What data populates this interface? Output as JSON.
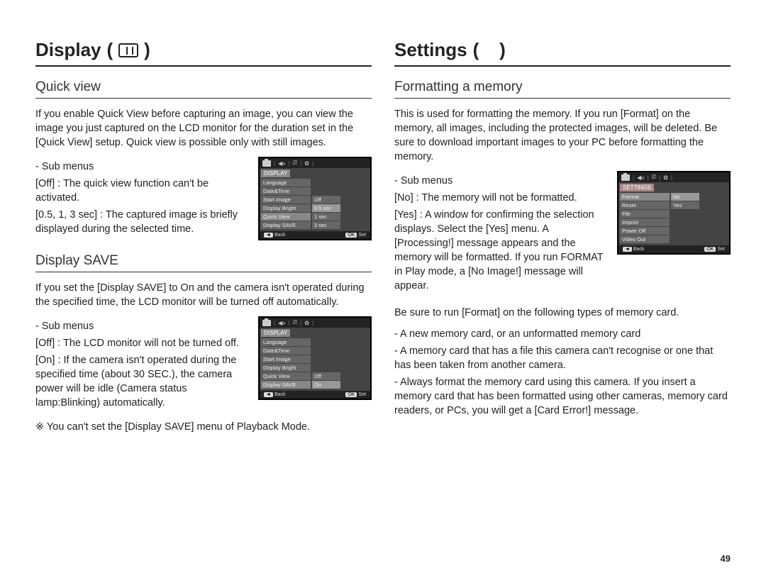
{
  "pageNumber": "49",
  "left": {
    "chapter": "Display",
    "sections": {
      "quickView": {
        "title": "Quick view",
        "para": "If you enable Quick View before capturing an image, you can view the image you just captured on the LCD monitor for the duration set in the [Quick View] setup. Quick view is possible only with still images.",
        "subMenusLabel": "- Sub menus",
        "items": [
          {
            "key": "[Off]",
            "desc": ": The quick view function can't be activated."
          },
          {
            "key": "[0.5, 1, 3 sec]",
            "desc": ": The captured image is brieﬂy displayed during the selected time."
          }
        ],
        "screenshot": {
          "header": "DISPLAY",
          "rows": [
            {
              "a": "Language",
              "b": ""
            },
            {
              "a": "Date&Time",
              "b": ""
            },
            {
              "a": "Start Image",
              "b": "Off"
            },
            {
              "a": "Display Bright",
              "b": "0.5 sec"
            },
            {
              "a": "Quick View",
              "b": "1 sec"
            },
            {
              "a": "Display SAVE",
              "b": "3 sec"
            }
          ],
          "footBack": "Back",
          "footOk": "OK",
          "footSet": "Set"
        }
      },
      "displaySave": {
        "title": "Display SAVE",
        "para": "If you set the [Display SAVE] to On and the camera isn't operated during the speciﬁed time, the LCD monitor will be turned off automatically.",
        "subMenusLabel": "- Sub menus",
        "items": [
          {
            "key": "[Off]",
            "desc": ": The LCD monitor will not be turned off."
          },
          {
            "key": "[On]",
            "desc": ": If the camera isn't operated during the speciﬁed time (about 30 SEC.), the camera power will be idle (Camera status lamp:Blinking) automatically."
          }
        ],
        "note": "※ You can't set the [Display SAVE] menu of Playback Mode.",
        "screenshot": {
          "header": "DISPLAY",
          "rows": [
            {
              "a": "Language",
              "b": ""
            },
            {
              "a": "Date&Time",
              "b": ""
            },
            {
              "a": "Start Image",
              "b": ""
            },
            {
              "a": "Display Bright",
              "b": ""
            },
            {
              "a": "Quick View",
              "b": "Off"
            },
            {
              "a": "Display SAVE",
              "b": "On"
            }
          ],
          "footBack": "Back",
          "footOk": "OK",
          "footSet": "Set"
        }
      }
    }
  },
  "right": {
    "chapter": "Settings",
    "sections": {
      "formatting": {
        "title": "Formatting a memory",
        "para": "This is used for formatting the memory. If you run [Format] on the memory, all images, including the protected images, will be deleted. Be sure to download important images to your PC before formatting the memory.",
        "subMenusLabel": "- Sub menus",
        "items": [
          {
            "key": "[No]",
            "desc": ": The memory will not be formatted."
          },
          {
            "key": "[Yes]",
            "desc": ": A window for conﬁrming the selection displays. Select the [Yes] menu. A [Processing!] message appears and the memory will be formatted. If you run FORMAT in Play mode, a [No Image!] message will appear."
          }
        ],
        "afterText": "Be sure to run [Format] on the following types of memory card.",
        "bullets": [
          "- A new memory card, or an unformatted memory card",
          "- A memory card that has a ﬁle this camera can't recognise or one that has been taken from another camera.",
          "- Always format the memory card using this camera. If you insert a memory card that has been formatted using other cameras, memory card readers, or PCs, you will get a [Card Error!] message."
        ],
        "screenshot": {
          "header": "SETTINGS",
          "rows": [
            {
              "a": "Format",
              "b": "No"
            },
            {
              "a": "Reset",
              "b": "Yes"
            },
            {
              "a": "File",
              "b": ""
            },
            {
              "a": "Imprint",
              "b": ""
            },
            {
              "a": "Power Off",
              "b": ""
            },
            {
              "a": "Video Out",
              "b": ""
            }
          ],
          "footBack": "Back",
          "footOk": "OK",
          "footSet": "Set"
        }
      }
    }
  }
}
